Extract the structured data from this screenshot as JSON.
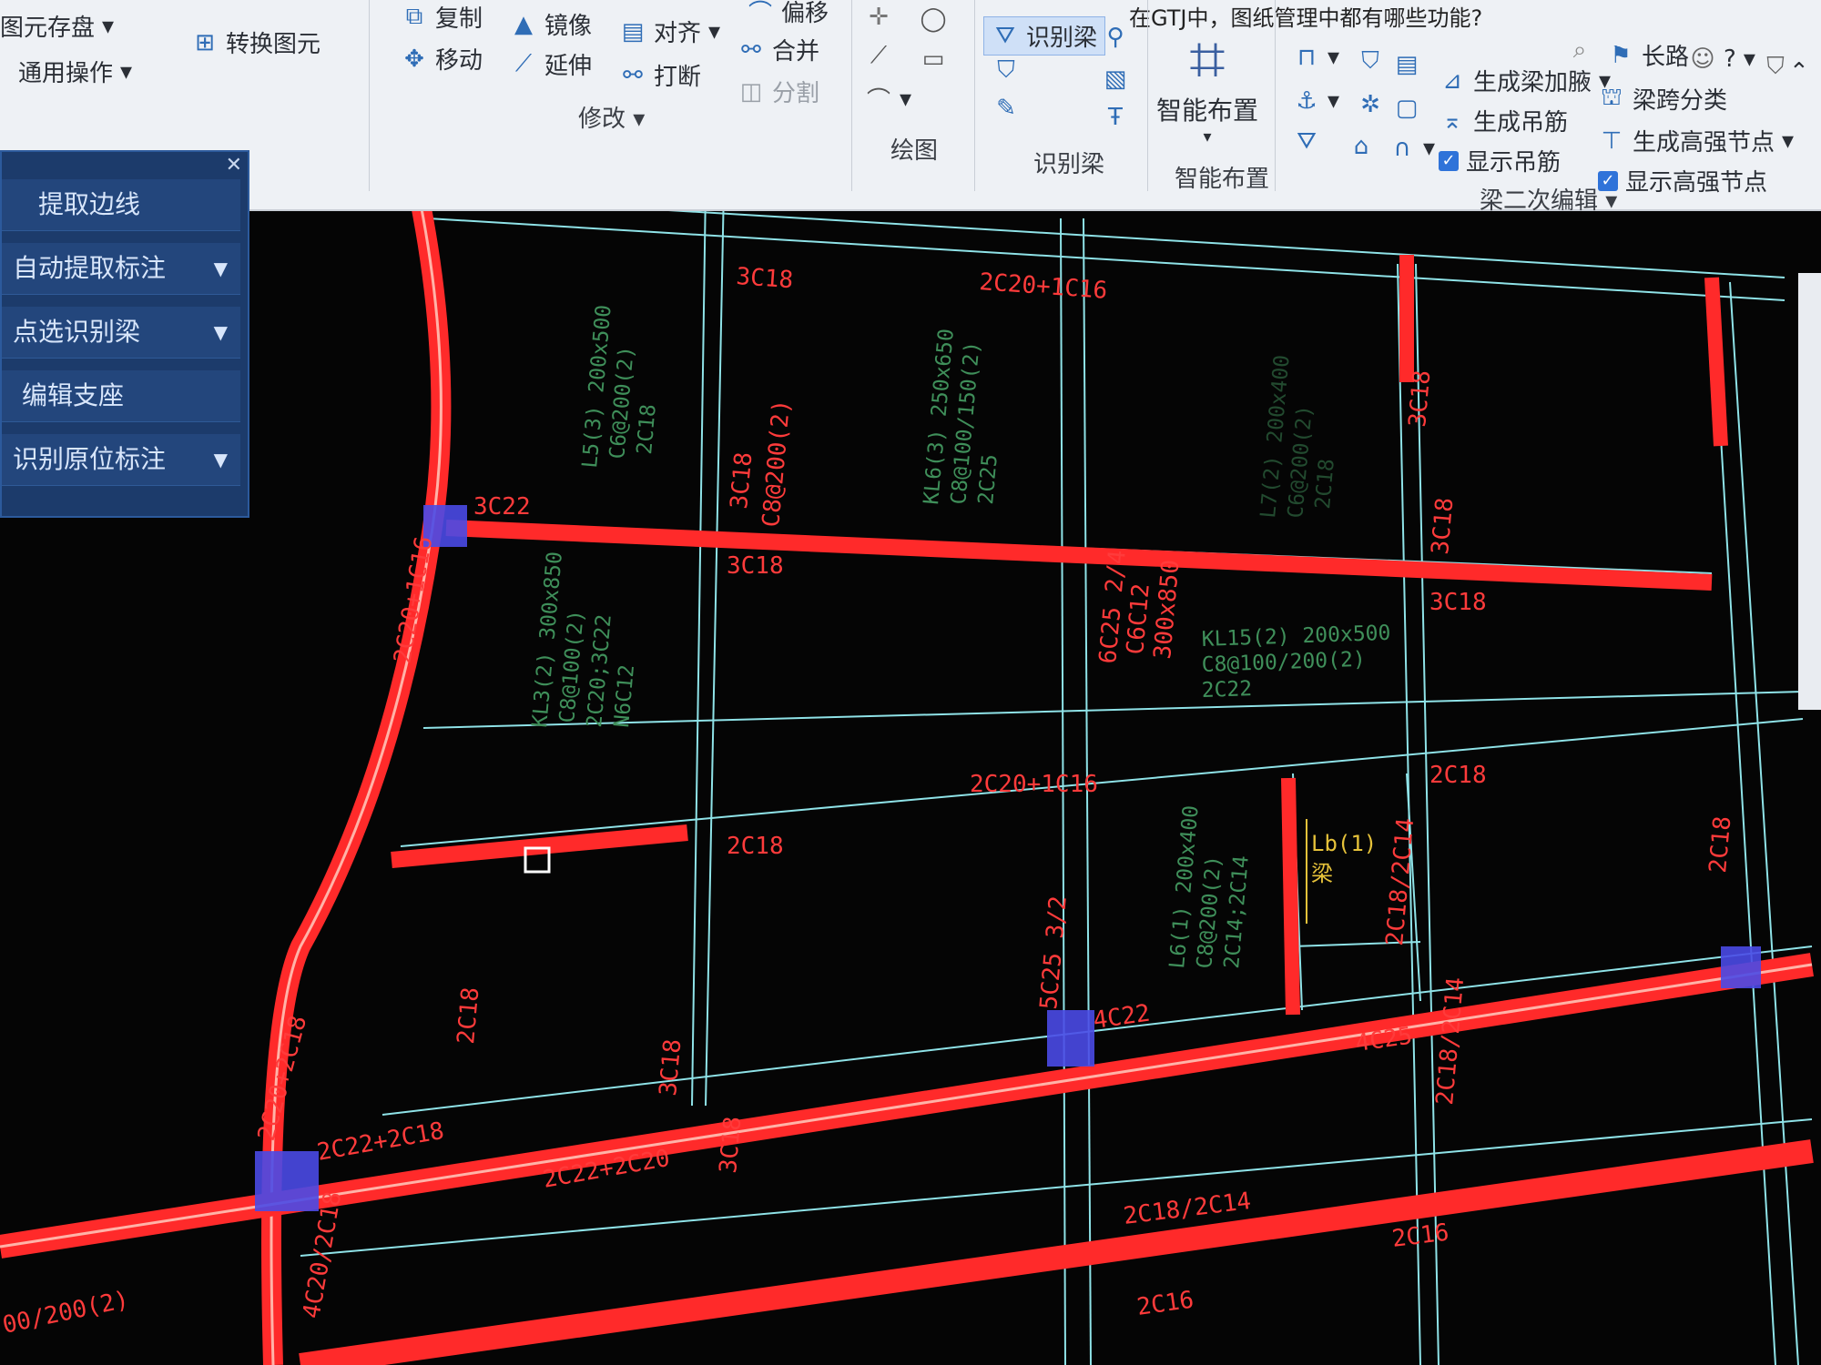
{
  "window": {
    "title": "在GTJ中，图纸管理中都有哪些功能?"
  },
  "ribbon": {
    "left_items": [
      {
        "label": "图元存盘",
        "icon": "save-icon"
      },
      {
        "label": "通用操作",
        "icon": "menu-icon"
      },
      {
        "label": "转换图元",
        "icon": "convert-icon"
      }
    ],
    "modify": {
      "group_label": "修改",
      "buttons": [
        {
          "label": "复制",
          "icon": "copy-icon"
        },
        {
          "label": "镜像",
          "icon": "mirror-icon"
        },
        {
          "label": "对齐",
          "icon": "align-icon"
        },
        {
          "label": "偏移",
          "icon": "offset-icon"
        },
        {
          "label": "移动",
          "icon": "move-icon"
        },
        {
          "label": "延伸",
          "icon": "extend-icon"
        },
        {
          "label": "打断",
          "icon": "break-icon"
        },
        {
          "label": "合并",
          "icon": "merge-icon"
        },
        {
          "label": "分割",
          "icon": "split-icon"
        }
      ]
    },
    "draw": {
      "group_label": "绘图"
    },
    "recognize_beam": {
      "group_label": "识别梁",
      "button_label": "识别梁"
    },
    "smart_layout": {
      "group_label": "智能布置",
      "button_label": "智能布置"
    },
    "beam_edit": {
      "group_label": "梁二次编辑",
      "buttons": [
        {
          "label": "生成梁加腋"
        },
        {
          "label": "生成吊筋"
        },
        {
          "label": "显示吊筋",
          "checked": true
        },
        {
          "label": "梁跨分类"
        },
        {
          "label": "生成高强节点"
        },
        {
          "label": "显示高强节点",
          "checked": true
        }
      ],
      "length_label": "长路"
    }
  },
  "panel": {
    "items": [
      {
        "label": "提取边线",
        "has_dropdown": false
      },
      {
        "label": "自动提取标注",
        "has_dropdown": true
      },
      {
        "label": "点选识别梁",
        "has_dropdown": true
      },
      {
        "label": "编辑支座",
        "has_dropdown": false
      },
      {
        "label": "识别原位标注",
        "has_dropdown": true
      }
    ]
  },
  "drawing": {
    "colors": {
      "background": "#050505",
      "beam": "#ff2a2a",
      "grid_line": "#8fe3e8",
      "support": "#4a4ae6",
      "text_red": "#ff3b3b",
      "text_green": "#3f8f5a",
      "text_yellow": "#e6c23a"
    },
    "red_labels": [
      "3C22",
      "2C20+1C16",
      "3C18",
      "2C20+1C16",
      "3C18",
      "2C18",
      "3C18",
      "2C20+1C16",
      "2C20+2C18",
      "2C22+2C18",
      "2C22+2C20",
      "4C22",
      "5C25 3/2",
      "4C20/2C18",
      "4C25",
      "2C18/2C14",
      "2C16",
      "3C18",
      "3C18",
      "2C18/2C14",
      "6C25 2/4",
      "C6C12",
      "300x850",
      "3C18",
      "C8@200(2)",
      "3C18",
      "2C16",
      "2C18",
      "3C18",
      "2C18",
      "2C18/2C14",
      "00/200(2)",
      "2C18"
    ],
    "green_labels": [
      "L5(3) 200x500",
      "C6@200(2)",
      "2C18",
      "KL6(3) 250x650",
      "C8@100/150(2)",
      "2C25",
      "KL3(2) 300x850",
      "C8@100(2)",
      "2C20;3C22",
      "N6C12",
      "KL15(2) 200x500",
      "C8@100/200(2)",
      "2C22",
      "L6(1) 200x400",
      "C8@200(2)",
      "2C14;2C14",
      "L7(2) 200x400",
      "C6@200(2)",
      "2C18"
    ],
    "yellow_labels": [
      "Lb(1)",
      "梁"
    ]
  }
}
